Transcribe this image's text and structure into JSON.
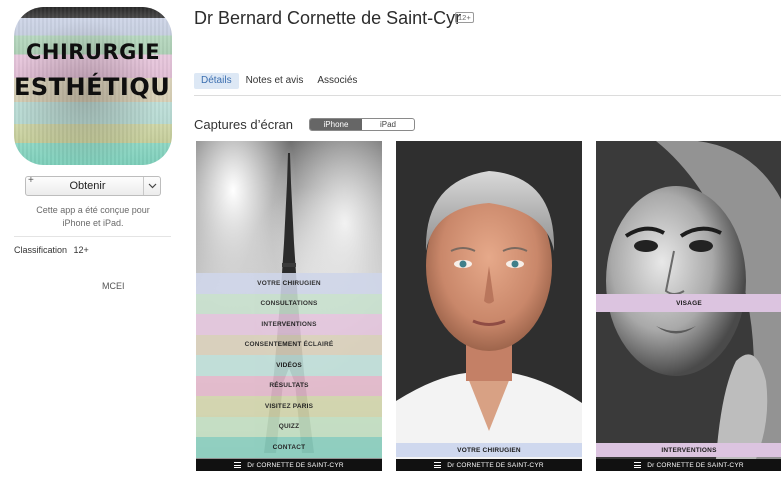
{
  "app": {
    "icon_line1": "CHIRURGIE",
    "icon_line2": "ESTHÉTIQUE",
    "title": "Dr Bernard Cornette de Saint-Cyr",
    "age_badge": "12+"
  },
  "sidebar": {
    "get_plus": "+",
    "get_label": "Obtenir",
    "compat_note": "Cette app a été conçue pour iPhone et iPad.",
    "rating_label": "Classification",
    "rating_value": "12+",
    "developer": "MCEI"
  },
  "tabs": [
    {
      "label": "Détails",
      "active": true
    },
    {
      "label": "Notes et avis",
      "active": false
    },
    {
      "label": "Associés",
      "active": false
    }
  ],
  "screenshots_section": {
    "title": "Captures d’écran",
    "devices": [
      {
        "label": "iPhone",
        "active": true
      },
      {
        "label": "iPad",
        "active": false
      }
    ]
  },
  "screenshots": {
    "brand_bar": "Dr CORNETTE DE SAINT-CYR",
    "shot1_menu": [
      {
        "label": "VOTRE CHIRUGIEN",
        "color": "#cfd6ea"
      },
      {
        "label": "CONSULTATIONS",
        "color": "#c9e2cf"
      },
      {
        "label": "INTERVENTIONS",
        "color": "#e6c7df"
      },
      {
        "label": "CONSENTEMENT ÉCLAIRÉ",
        "color": "#ddd3bd"
      },
      {
        "label": "VIDÉOS",
        "color": "#c2e2dc"
      },
      {
        "label": "RÉSULTATS",
        "color": "#e8bccf"
      },
      {
        "label": "VISITEZ PARIS",
        "color": "#d8dbb0"
      },
      {
        "label": "QUIZZ",
        "color": "#c9e6c8"
      },
      {
        "label": "CONTACT",
        "color": "#8fd6c5"
      }
    ],
    "shot2_caption": "VOTRE CHIRUGIEN",
    "shot2_caption_color": "#cfd8ee",
    "shot3_caption_top": "VISAGE",
    "shot3_caption_bottom": "INTERVENTIONS",
    "shot3_caption_color": "#dcc4e0"
  }
}
